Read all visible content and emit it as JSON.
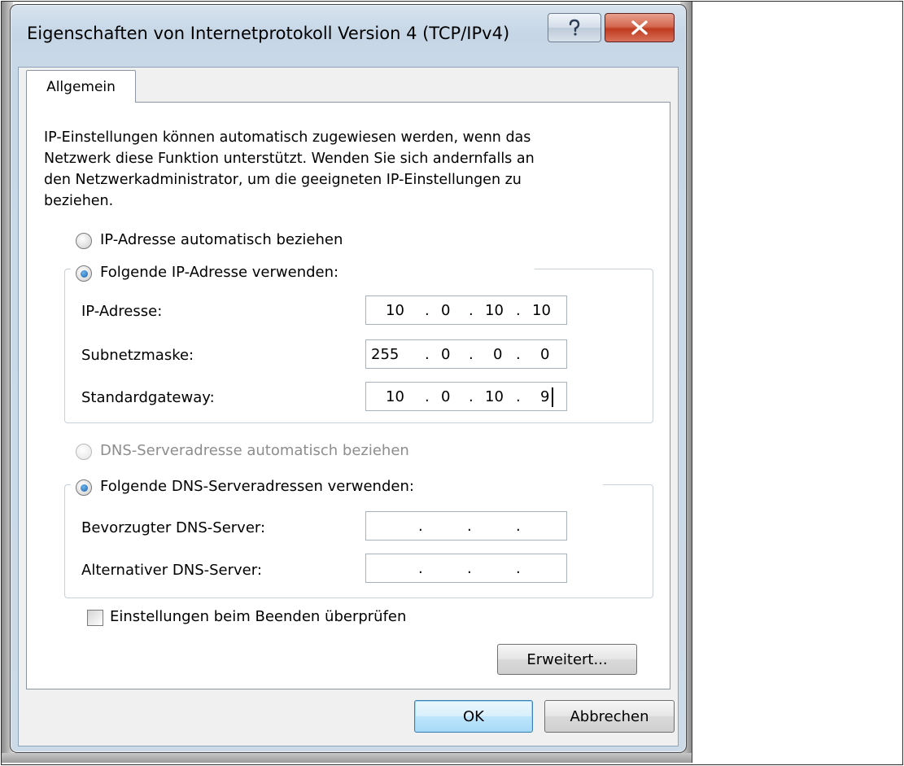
{
  "window": {
    "title": "Eigenschaften von Internetprotokoll Version 4 (TCP/IPv4)"
  },
  "title_bar": {
    "help_icon": "help-icon",
    "close_icon": "close-icon"
  },
  "tabs": [
    {
      "label": "Allgemein",
      "selected": true
    }
  ],
  "general": {
    "intro_lines": [
      "IP-Einstellungen können automatisch zugewiesen werden, wenn das",
      "Netzwerk diese Funktion unterstützt. Wenden Sie sich andernfalls an",
      "den Netzwerkadministrator, um die geeigneten IP-Einstellungen zu",
      "beziehen."
    ],
    "ip_auto_label": "IP-Adresse automatisch beziehen",
    "ip_manual_label": "Folgende IP-Adresse verwenden:",
    "ip_mode_selected": "manual",
    "ip_fields": {
      "ip_address": {
        "label": "IP-Adresse:",
        "octets": [
          "10",
          "0",
          "10",
          "10"
        ]
      },
      "subnet_mask": {
        "label": "Subnetzmaske:",
        "octets": [
          "255",
          "0",
          "0",
          "0"
        ]
      },
      "gateway": {
        "label": "Standardgateway:",
        "octets": [
          "10",
          "0",
          "10",
          "9"
        ]
      }
    },
    "dns_auto_label": "DNS-Serveradresse automatisch beziehen",
    "dns_manual_label": "Folgende DNS-Serveradressen verwenden:",
    "dns_mode_selected": "manual",
    "dns_fields": {
      "preferred": {
        "label": "Bevorzugter DNS-Server:",
        "octets": [
          "",
          "",
          "",
          ""
        ]
      },
      "alternate": {
        "label": "Alternativer DNS-Server:",
        "octets": [
          "",
          "",
          "",
          ""
        ]
      }
    },
    "validate_label": "Einstellungen beim Beenden überprüfen",
    "validate_checked": false,
    "advanced_label": "Erweitert..."
  },
  "dialog_buttons": {
    "ok_label": "OK",
    "cancel_label": "Abbrechen"
  },
  "dot": ".",
  "colors": {
    "close_button": "#c84a2f",
    "default_button": "#bee6fd",
    "title_bar": "#c6d6e6"
  }
}
